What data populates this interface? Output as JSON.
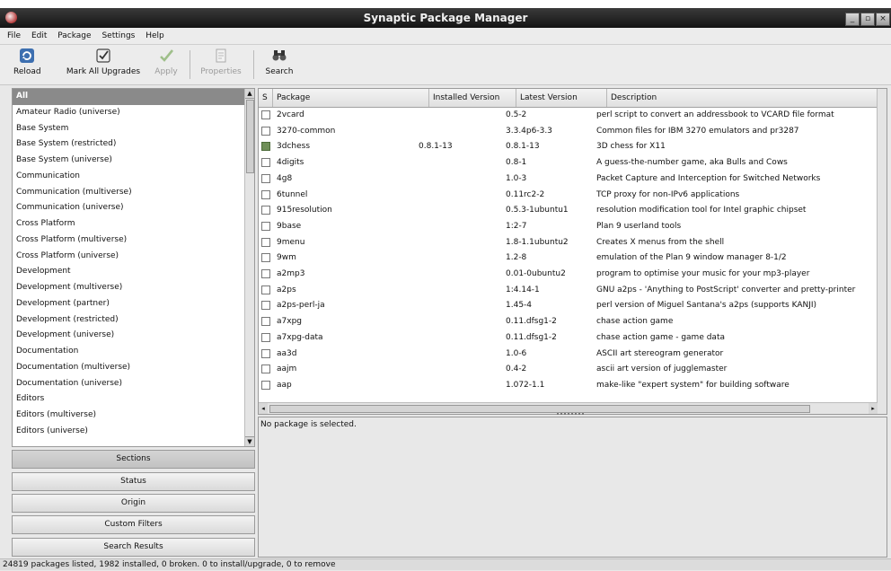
{
  "window": {
    "title": "Synaptic Package Manager",
    "controls": [
      "_",
      "▫",
      "×"
    ]
  },
  "menubar": [
    "File",
    "Edit",
    "Package",
    "Settings",
    "Help"
  ],
  "toolbar": {
    "reload": "Reload",
    "mark_all_upgrades": "Mark All Upgrades",
    "apply": "Apply",
    "properties": "Properties",
    "search": "Search"
  },
  "sections": [
    "All",
    "Amateur Radio (universe)",
    "Base System",
    "Base System (restricted)",
    "Base System (universe)",
    "Communication",
    "Communication (multiverse)",
    "Communication (universe)",
    "Cross Platform",
    "Cross Platform (multiverse)",
    "Cross Platform (universe)",
    "Development",
    "Development (multiverse)",
    "Development (partner)",
    "Development (restricted)",
    "Development (universe)",
    "Documentation",
    "Documentation (multiverse)",
    "Documentation (universe)",
    "Editors",
    "Editors (multiverse)",
    "Editors (universe)"
  ],
  "filter_buttons": [
    "Sections",
    "Status",
    "Origin",
    "Custom Filters",
    "Search Results"
  ],
  "table": {
    "headers": {
      "s": "S",
      "package": "Package",
      "installed": "Installed Version",
      "latest": "Latest Version",
      "description": "Description"
    },
    "rows": [
      {
        "installed_state": false,
        "package": "2vcard",
        "installed": "",
        "latest": "0.5-2",
        "description": "perl script to convert an addressbook to VCARD file format"
      },
      {
        "installed_state": false,
        "package": "3270-common",
        "installed": "",
        "latest": "3.3.4p6-3.3",
        "description": "Common files for IBM 3270 emulators and pr3287"
      },
      {
        "installed_state": true,
        "package": "3dchess",
        "installed": "0.8.1-13",
        "latest": "0.8.1-13",
        "description": "3D chess for X11"
      },
      {
        "installed_state": false,
        "package": "4digits",
        "installed": "",
        "latest": "0.8-1",
        "description": "A guess-the-number game, aka Bulls and Cows"
      },
      {
        "installed_state": false,
        "package": "4g8",
        "installed": "",
        "latest": "1.0-3",
        "description": "Packet Capture and Interception for Switched Networks"
      },
      {
        "installed_state": false,
        "package": "6tunnel",
        "installed": "",
        "latest": "0.11rc2-2",
        "description": "TCP proxy for non-IPv6 applications"
      },
      {
        "installed_state": false,
        "package": "915resolution",
        "installed": "",
        "latest": "0.5.3-1ubuntu1",
        "description": "resolution modification tool for Intel graphic chipset"
      },
      {
        "installed_state": false,
        "package": "9base",
        "installed": "",
        "latest": "1:2-7",
        "description": "Plan 9 userland tools"
      },
      {
        "installed_state": false,
        "package": "9menu",
        "installed": "",
        "latest": "1.8-1.1ubuntu2",
        "description": "Creates X menus from the shell"
      },
      {
        "installed_state": false,
        "package": "9wm",
        "installed": "",
        "latest": "1.2-8",
        "description": "emulation of the Plan 9 window manager 8-1/2"
      },
      {
        "installed_state": false,
        "package": "a2mp3",
        "installed": "",
        "latest": "0.01-0ubuntu2",
        "description": "program to optimise your music for your mp3-player"
      },
      {
        "installed_state": false,
        "package": "a2ps",
        "installed": "",
        "latest": "1:4.14-1",
        "description": "GNU a2ps - 'Anything to PostScript' converter and pretty-printer"
      },
      {
        "installed_state": false,
        "package": "a2ps-perl-ja",
        "installed": "",
        "latest": "1.45-4",
        "description": "perl version of Miguel Santana's a2ps (supports KANJI)"
      },
      {
        "installed_state": false,
        "package": "a7xpg",
        "installed": "",
        "latest": "0.11.dfsg1-2",
        "description": "chase action game"
      },
      {
        "installed_state": false,
        "package": "a7xpg-data",
        "installed": "",
        "latest": "0.11.dfsg1-2",
        "description": "chase action game - game data"
      },
      {
        "installed_state": false,
        "package": "aa3d",
        "installed": "",
        "latest": "1.0-6",
        "description": "ASCII art stereogram generator"
      },
      {
        "installed_state": false,
        "package": "aajm",
        "installed": "",
        "latest": "0.4-2",
        "description": "ascii art version of jugglemaster"
      },
      {
        "installed_state": false,
        "package": "aap",
        "installed": "",
        "latest": "1.072-1.1",
        "description": "make-like \"expert system\" for building software"
      }
    ]
  },
  "details": {
    "message": "No package is selected."
  },
  "statusbar": "24819 packages listed, 1982 installed, 0 broken. 0 to install/upgrade, 0 to remove"
}
